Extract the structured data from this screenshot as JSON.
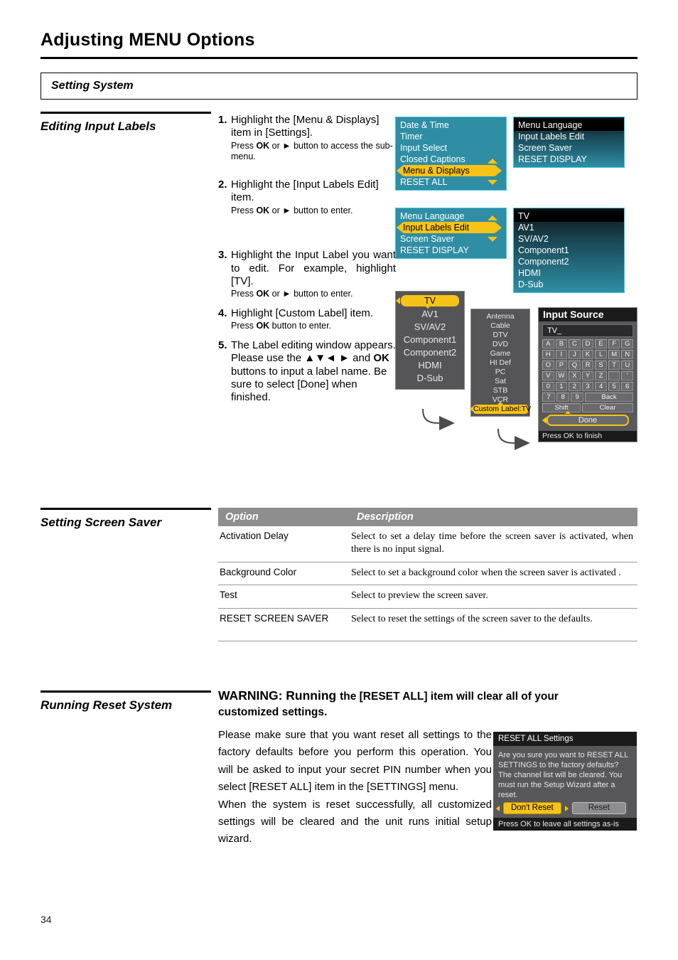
{
  "header": {
    "title": "Adjusting MENU Options",
    "section": "Setting System"
  },
  "sections": {
    "editing_input_labels": "Editing Input Labels",
    "setting_screen_saver": "Setting Screen Saver",
    "running_reset_system": "Running Reset System"
  },
  "steps": [
    {
      "num": "1.",
      "main": "Highlight the [Menu & Displays] item in [Settings].",
      "sub_pre": "Press ",
      "sub_ok": "OK",
      "sub_mid": " or ► button to access the sub-menu."
    },
    {
      "num": "2.",
      "main": "Highlight the [Input Labels Edit] item.",
      "sub_pre": "Press ",
      "sub_ok": "OK",
      "sub_mid": " or ► button to enter."
    },
    {
      "num": "3.",
      "main": "Highlight the Input Label you want to edit. For example, highlight [TV].",
      "sub_pre": "Press ",
      "sub_ok": "OK",
      "sub_mid": " or ► button to enter."
    },
    {
      "num": "4.",
      "main": "Highlight [Custom Label] item.",
      "sub_pre": "Press ",
      "sub_ok": "OK",
      "sub_mid": " button to enter."
    },
    {
      "num": "5.",
      "main_a": "The Label editing window appears. Please use the ",
      "main_arrows": "▲▼◄ ►",
      "main_b": " and ",
      "main_ok": "OK",
      "main_c": " buttons to input a label name. Be sure to select [Done] when finished."
    }
  ],
  "osd": {
    "settings_menu": {
      "items": [
        "Date & Time",
        "Timer",
        "Input Select",
        "Closed Captions",
        "Menu & Displays",
        "RESET ALL"
      ],
      "highlighted": "Menu & Displays"
    },
    "menu_displays_submenu": {
      "items": [
        "Menu Language",
        "Input Labels Edit",
        "Screen Saver",
        "RESET DISPLAY"
      ],
      "highlighted": "Menu Language"
    },
    "menu_displays_menu2": {
      "items": [
        "Menu Language",
        "Input Labels Edit",
        "Screen Saver",
        "RESET DISPLAY"
      ],
      "highlighted": "Input Labels Edit"
    },
    "input_list": {
      "items": [
        "TV",
        "AV1",
        "SV/AV2",
        "Component1",
        "Component2",
        "HDMI",
        "D-Sub"
      ],
      "highlighted": "TV"
    },
    "input_list2": {
      "items": [
        "TV",
        "AV1",
        "SV/AV2",
        "Component1",
        "Component2",
        "HDMI",
        "D-Sub"
      ],
      "highlighted": "TV"
    },
    "label_list": {
      "items": [
        "Antenna",
        "Cable",
        "DTV",
        "DVD",
        "Game",
        "HI Def",
        "PC",
        "Sat",
        "STB",
        "VCR"
      ],
      "highlighted": "Custom Label:TV"
    },
    "input_source_dialog": {
      "title": "Input Source",
      "field_value": "TV_",
      "keys_row1": [
        "A",
        "B",
        "C",
        "D",
        "E",
        "F",
        "G"
      ],
      "keys_row2": [
        "H",
        "I",
        "J",
        "K",
        "L",
        "M",
        "N"
      ],
      "keys_row3": [
        "O",
        "P",
        "Q",
        "R",
        "S",
        "T",
        "U"
      ],
      "keys_row4": [
        "V",
        "W",
        "X",
        "Y",
        "Z",
        "",
        "’"
      ],
      "keys_row5": [
        "0",
        "1",
        "2",
        "3",
        "4",
        "5",
        "6"
      ],
      "keys_row6": [
        "7",
        "8",
        "9"
      ],
      "back_label": "Back",
      "shift_label": "Shift",
      "clear_label": "Clear",
      "done_label": "Done",
      "footer": "Press OK to finish"
    }
  },
  "screen_saver_table": {
    "headers": [
      "Option",
      "Description"
    ],
    "rows": [
      {
        "option": "Activation Delay",
        "description": "Select to set a delay time before the screen saver is activated, when there is no input signal."
      },
      {
        "option": "Background Color",
        "description": "Select to set a background color when the screen saver is activated ."
      },
      {
        "option": "Test",
        "description": "Select to preview the screen saver."
      },
      {
        "option": "RESET SCREEN SAVER",
        "description": "Select to reset the settings of the screen saver to the defaults."
      }
    ]
  },
  "warning": {
    "title_a": "WARNING: Running ",
    "title_b": "the [RESET ALL] item will clear all of your",
    "title_c": "customized settings.",
    "body": "Please make sure that you want reset all settings to the factory defaults before you perform this operation. You will be asked to input your secret PIN number when you select [RESET ALL] item in the [SETTINGS] menu.",
    "body2": "When the system is reset successfully, all customized settings will be cleared and the unit runs initial setup wizard."
  },
  "reset_dialog": {
    "title": "RESET ALL Settings",
    "body": "Are you sure you want to RESET ALL SETTINGS to the factory defaults? The channel list will be cleared. You must run the Setup Wizard after a reset.",
    "dont_reset": "Don't Reset",
    "reset": "Reset",
    "footer": "Press OK to leave all settings as-is"
  },
  "page_number": "34",
  "colors": {
    "osd_teal": "#2f8ea4",
    "osd_teal_border": "#39c6e8",
    "highlight_yellow": "#f7c317",
    "gray_panel": "#555558",
    "table_header_gray": "#8e8e8e"
  }
}
